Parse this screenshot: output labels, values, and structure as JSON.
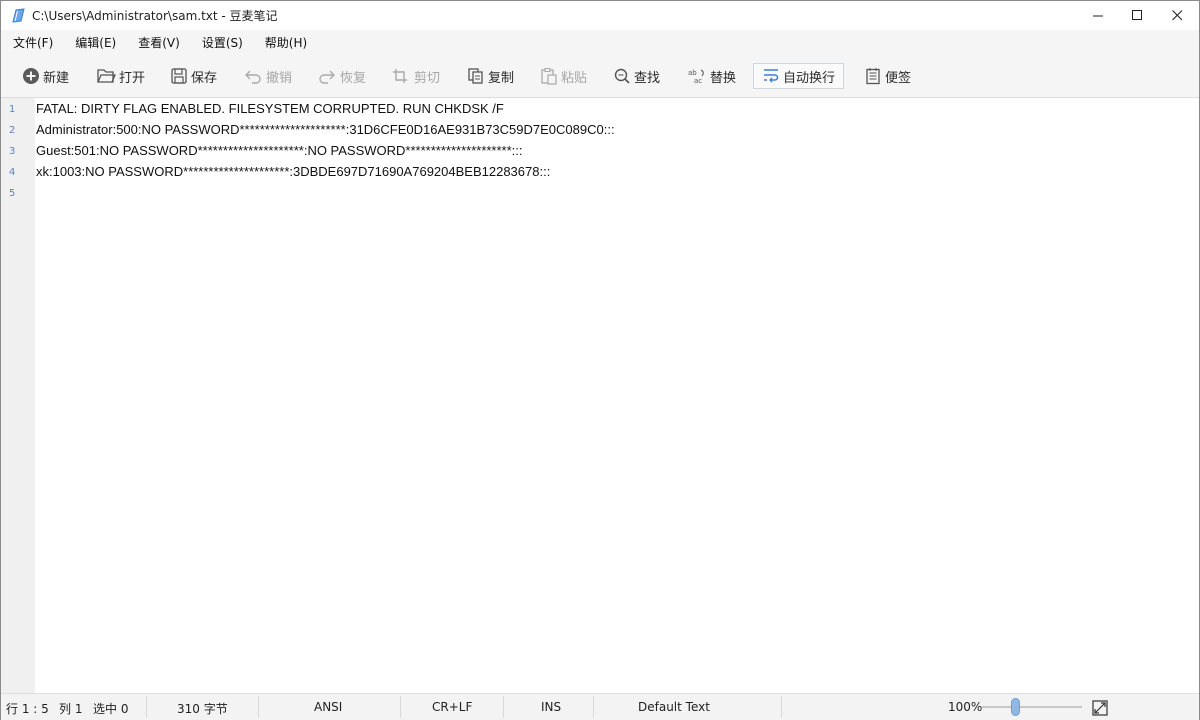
{
  "window": {
    "title": "C:\\Users\\Administrator\\sam.txt - 豆麦笔记",
    "controls": {
      "minimize": "minimize",
      "maximize": "maximize",
      "close": "close"
    }
  },
  "menu": [
    "文件(F)",
    "编辑(E)",
    "查看(V)",
    "设置(S)",
    "帮助(H)"
  ],
  "toolbar": {
    "new": "新建",
    "open": "打开",
    "save": "保存",
    "undo": "撤销",
    "redo": "恢复",
    "cut": "剪切",
    "copy": "复制",
    "paste": "粘贴",
    "find": "查找",
    "replace": "替换",
    "wordwrap": "自动换行",
    "notes": "便签"
  },
  "toolbar_state": {
    "undo_enabled": false,
    "redo_enabled": false,
    "cut_enabled": false,
    "paste_enabled": false,
    "wordwrap_active": true
  },
  "editor": {
    "line_numbers": [
      "1",
      "2",
      "3",
      "4",
      "5"
    ],
    "lines": [
      "FATAL: DIRTY FLAG ENABLED. FILESYSTEM CORRUPTED. RUN CHKDSK /F",
      "Administrator:500:NO PASSWORD*********************:31D6CFE0D16AE931B73C59D7E0C089C0:::",
      "Guest:501:NO PASSWORD*********************:NO PASSWORD*********************:::",
      "xk:1003:NO PASSWORD*********************:3DBDE697D71690A769204BEB12283678:::",
      ""
    ]
  },
  "status": {
    "position": "行 1 : 5",
    "column": "列 1",
    "selection": "选中 0",
    "bytes": "310 字节",
    "encoding": "ANSI",
    "line_ending": "CR+LF",
    "insert_mode": "INS",
    "syntax": "Default Text",
    "zoom": "100%",
    "zoom_level_percent": 100
  },
  "colors": {
    "accent": "#3c7fd1",
    "line_number": "#5f84b8",
    "gutter": "#f0f0f0",
    "toolbar": "#f5f5f5"
  },
  "icons": [
    "notepad-icon",
    "minimize-icon",
    "maximize-icon",
    "close-icon",
    "new-icon",
    "open-icon",
    "save-icon",
    "undo-icon",
    "redo-icon",
    "cut-icon",
    "copy-icon",
    "paste-icon",
    "find-icon",
    "replace-icon",
    "wordwrap-icon",
    "notes-icon",
    "fit-window-icon"
  ]
}
